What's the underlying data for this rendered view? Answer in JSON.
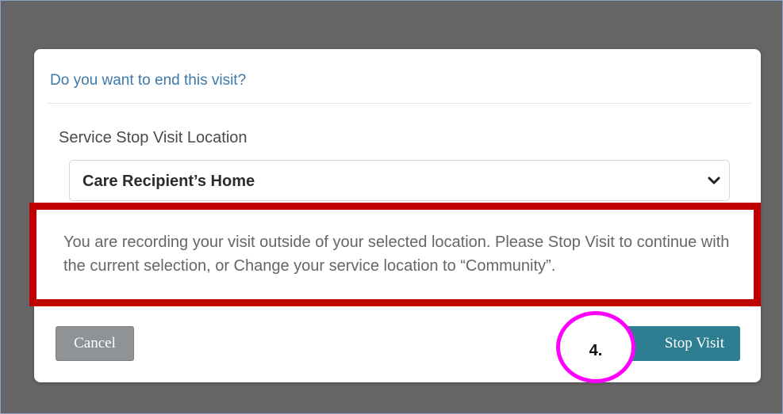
{
  "dialog": {
    "title": "Do you want to end this visit?",
    "field_label": "Service Stop Visit Location",
    "select": {
      "selected_value": "Care Recipient’s Home"
    },
    "warning_message": "You are recording your visit outside of your selected location. Please Stop Visit to continue with the current selection, or Change your service location to “Community”.",
    "buttons": {
      "cancel_label": "Cancel",
      "stop_visit_label": "Stop Visit"
    }
  },
  "annotation": {
    "step_label": "4."
  },
  "icons": {
    "select_arrow": "chevron-down-icon"
  },
  "colors": {
    "title": "#3d78a8",
    "warning_border": "#c00000",
    "stop_button": "#2e7e91",
    "cancel_button": "#8f9396",
    "annotation_circle": "#ff00ff",
    "overlay": "#656565"
  }
}
